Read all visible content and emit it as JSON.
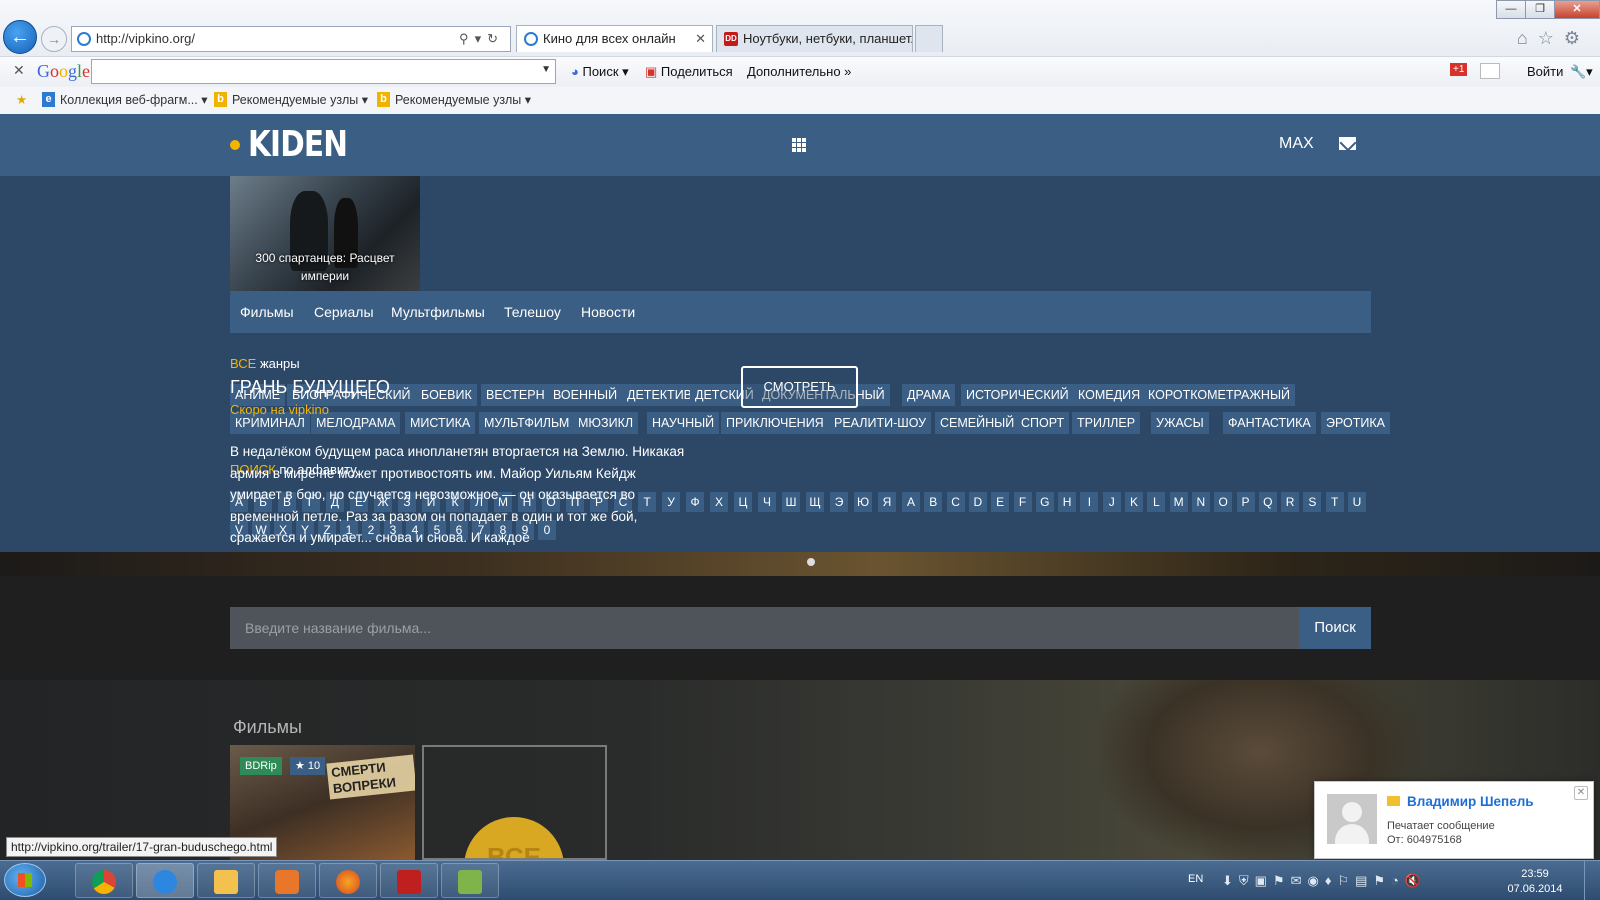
{
  "browser": {
    "url": "http://vipkino.org/",
    "tabs": [
      {
        "title": "Кино для всех онлайн"
      },
      {
        "title": "Ноутбуки, нетбуки, планшет..."
      }
    ],
    "window_buttons": [
      "—",
      "❐",
      "✕"
    ],
    "google_bar": {
      "logo": "Google",
      "search_label": "Поиск",
      "share_label": "Поделиться",
      "more_label": "Дополнительно »",
      "gplus": "+1",
      "signin_label": "Войти"
    },
    "favorites": [
      "Коллекция веб-фрагм...",
      "Рекомендуемые узлы",
      "Рекомендуемые узлы"
    ]
  },
  "site": {
    "logo": "KIDEN",
    "user": "MAX",
    "poster_caption": "300 спартанцев: Расцвет империи",
    "menu": [
      "Фильмы",
      "Сериалы",
      "Мультфильмы",
      "Телешоу",
      "Новости"
    ],
    "genres_label_accent": "ВСЕ",
    "genres_label": "жанры",
    "genres_row1": [
      "АНИМЕ",
      "БИОГРАФИЧЕСКИЙ",
      "БОЕВИК",
      "ВЕСТЕРН",
      "ВОЕННЫЙ",
      "ДЕТЕКТИВ",
      "ДЕТСКИЙ",
      "ДОКУМЕНТАЛЬНЫЙ",
      "ДРАМА",
      "ИСТОРИЧЕСКИЙ",
      "КОМЕДИЯ",
      "КОРОТКОМЕТРАЖНЫЙ"
    ],
    "genres_row2": [
      "КРИМИНАЛ",
      "МЕЛОДРАМА",
      "МИСТИКА",
      "МУЛЬТФИЛЬМ",
      "МЮЗИКЛ",
      "НАУЧНЫЙ",
      "ПРИКЛЮЧЕНИЯ",
      "РЕАЛИТИ-ШОУ",
      "СЕМЕЙНЫЙ",
      "СПОРТ",
      "ТРИЛЛЕР",
      "УЖАСЫ",
      "ФАНТАСТИКА",
      "ЭРОТИКА"
    ],
    "search_label_accent": "ПОИСК",
    "search_label": "по алфавиту",
    "alphabet_row1": [
      "А",
      "Б",
      "В",
      "Г",
      "Д",
      "Е",
      "Ж",
      "З",
      "И",
      "К",
      "Л",
      "М",
      "Н",
      "О",
      "П",
      "Р",
      "С",
      "Т",
      "У",
      "Ф",
      "Х",
      "Ц",
      "Ч",
      "Ш",
      "Щ",
      "Э",
      "Ю",
      "Я",
      "A",
      "B",
      "C",
      "D",
      "E",
      "F",
      "G",
      "H",
      "I",
      "J",
      "K",
      "L",
      "M",
      "N",
      "O",
      "P",
      "Q",
      "R",
      "S",
      "T",
      "U"
    ],
    "alphabet_row2": [
      "V",
      "W",
      "X",
      "Y",
      "Z",
      "1",
      "2",
      "3",
      "4",
      "5",
      "6",
      "7",
      "8",
      "9",
      "0"
    ],
    "slide": {
      "title": "ГРАНЬ БУДУЩЕГО",
      "soon": "Скоро на vipkino",
      "description": "В недалёком будущем раса инопланетян вторгается на Землю. Никакая армия в мире не может противостоять им. Майор Уильям Кейдж умирает в бою, но случается невозможное — он оказывается во временной петле. Раз за разом он попадает в один и тот же бой, сражается и умирает... снова и снова. И каждое",
      "watch_label": "СМОТРЕТЬ"
    },
    "search": {
      "placeholder": "Введите название фильма...",
      "button": "Поиск"
    },
    "films_title": "Фильмы",
    "film_card": {
      "quality": "BDRip",
      "rating": "★ 10",
      "poster_text": "СМЕРТИ ВОПРЕКИ"
    },
    "film_card2_text": "ВСЕ"
  },
  "status_url": "http://vipkino.org/trailer/17-gran-buduschego.html",
  "notification": {
    "name": "Владимир Шепель",
    "status": "Печатает сообщение",
    "from": "От: 604975168"
  },
  "taskbar": {
    "lang": "EN",
    "time": "23:59",
    "date": "07.06.2014"
  },
  "colors": {
    "site_blue": "#3b5e84",
    "accent_yellow": "#f4b400",
    "panel": "#2c4866"
  }
}
